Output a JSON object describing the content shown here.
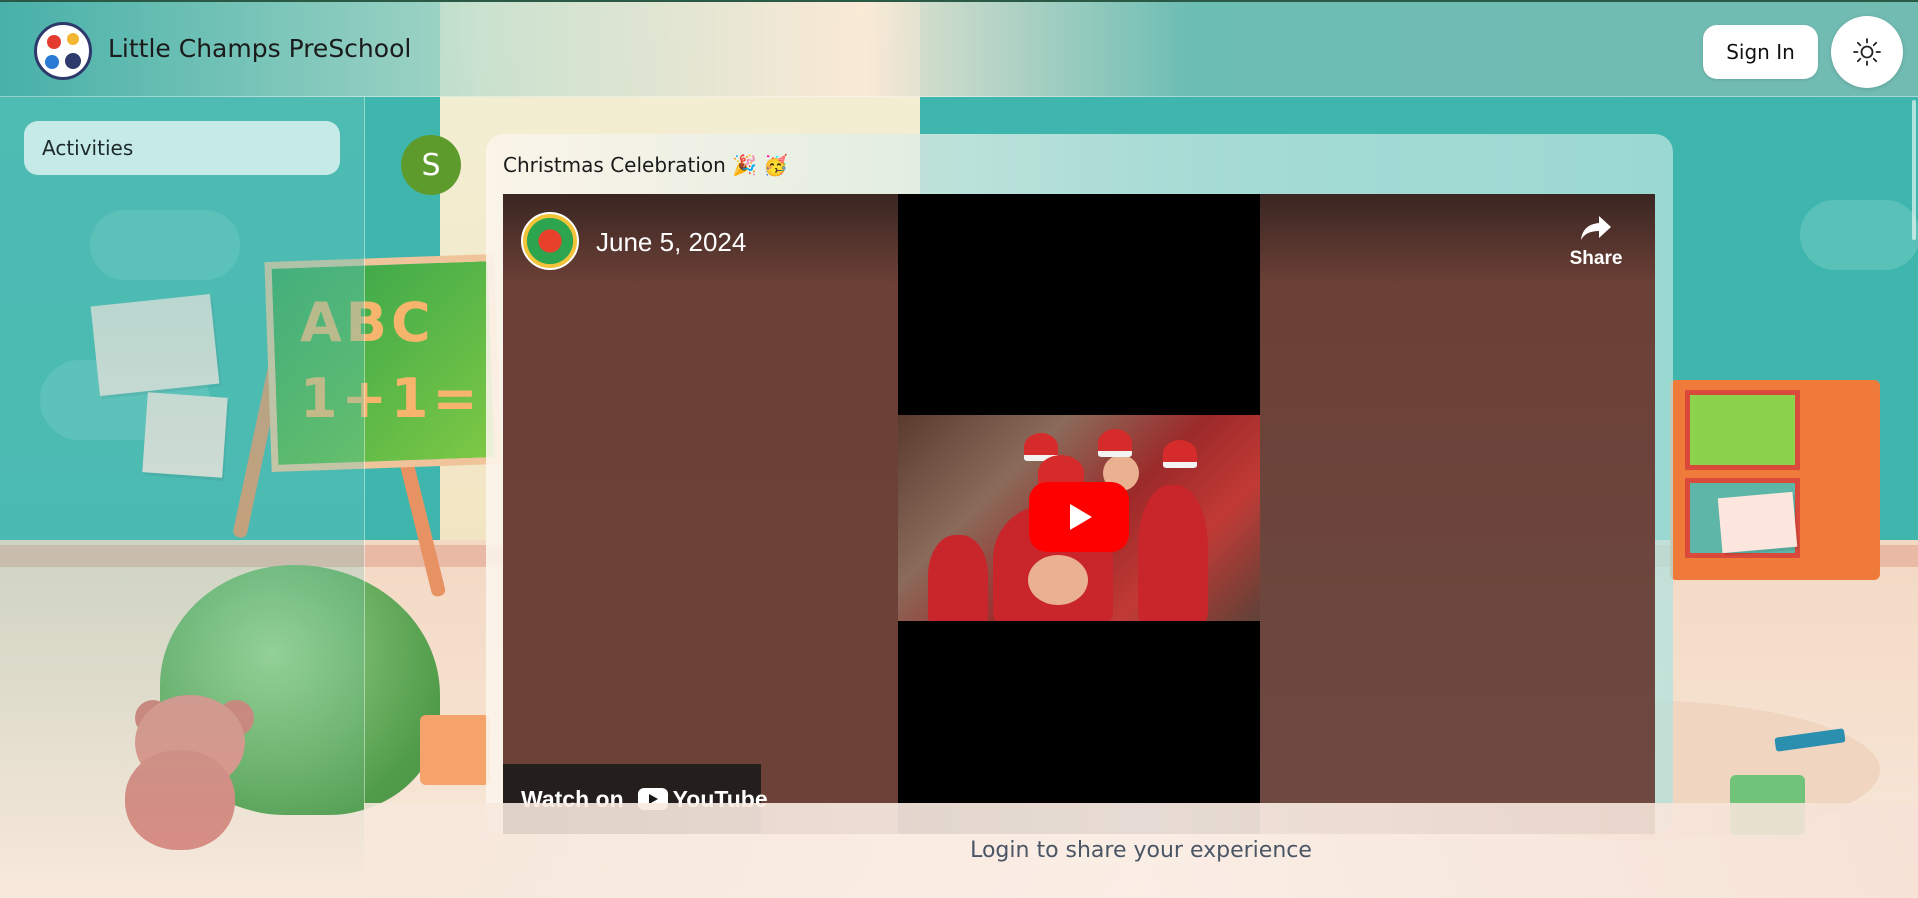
{
  "header": {
    "brand": "Little Champs PreSchool",
    "signin_label": "Sign In",
    "theme_icon": "sun-icon"
  },
  "sidebar": {
    "items": [
      {
        "label": "Activities"
      }
    ]
  },
  "post": {
    "author_initial": "S",
    "title": "Christmas Celebration 🎉 🥳",
    "video": {
      "date": "June 5, 2024",
      "share_label": "Share",
      "watch_label": "Watch on",
      "platform": "YouTube",
      "play_icon": "play-icon"
    }
  },
  "footer": {
    "login_prompt": "Login to share your experience"
  },
  "colors": {
    "avatar": "#5d9b2d",
    "play_button": "#ff0000",
    "brand_text": "#1b1b1b"
  }
}
